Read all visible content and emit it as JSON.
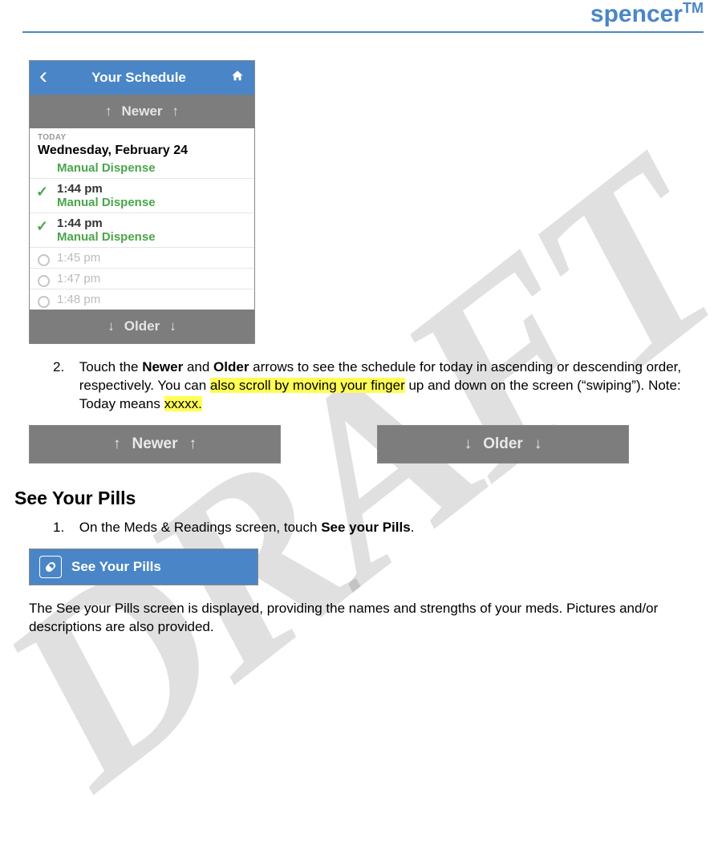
{
  "brand": {
    "name": "spencer",
    "tm": "TM"
  },
  "watermark": "DRAFT",
  "phone": {
    "header_title": "Your Schedule",
    "newer_label": "Newer",
    "older_label": "Older",
    "today_label": "TODAY",
    "date": "Wednesday, February 24",
    "rows": [
      {
        "dispense": "Manual Dispense"
      },
      {
        "time": "1:44 pm",
        "dispense": "Manual Dispense"
      },
      {
        "time": "1:44 pm",
        "dispense": "Manual Dispense"
      },
      {
        "time": "1:45 pm"
      },
      {
        "time": "1:47 pm"
      },
      {
        "time": "1:48 pm"
      }
    ]
  },
  "step2": {
    "num": "2.",
    "t1": "Touch the ",
    "b1": "Newer",
    "t2": " and ",
    "b2": "Older",
    "t3": " arrows to see the schedule for today in ascending or descending order, respectively. You can ",
    "hl1": "also scroll by moving your finger",
    "t4": " up and down on the screen (“swiping”). Note: Today means ",
    "hl2": "xxxxx."
  },
  "bigbtns": {
    "newer": "Newer",
    "older": "Older"
  },
  "section2": {
    "heading": "See Your Pills"
  },
  "step1": {
    "num": "1.",
    "t1": "On the Meds & Readings screen, touch ",
    "b1": "See your Pills",
    "t2": "."
  },
  "pillbtn": {
    "label": "See Your Pills"
  },
  "para_end": "The See your Pills screen is displayed, providing the names and strengths of your meds.  Pictures and/or descriptions are also provided."
}
